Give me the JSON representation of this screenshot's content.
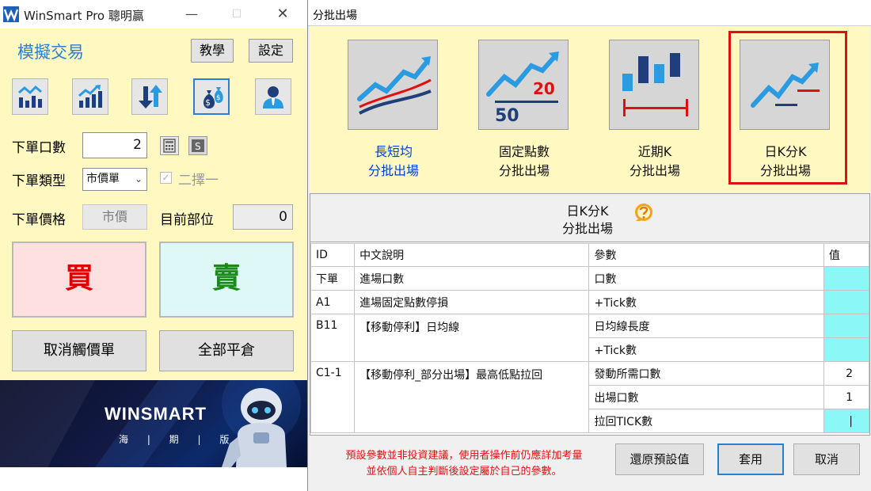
{
  "left_window": {
    "title": "WinSmart Pro 聰明贏",
    "controls": {
      "minimize": "—",
      "maximize": "☐",
      "close": "✕"
    },
    "simulated_trading_title": "模擬交易",
    "tutorial_label": "教學",
    "settings_label": "設定",
    "tool_icons": [
      "bar-chart-icon",
      "trend-chart-icon",
      "transfer-arrows-icon",
      "money-bag-icon",
      "user-icon"
    ],
    "qty_label": "下單口數",
    "qty_value": "2",
    "order_type_label": "下單類型",
    "order_type_value": "市價單",
    "either_label": "二擇一",
    "either_checked": true,
    "price_label": "下單價格",
    "price_value": "市價",
    "position_label": "目前部位",
    "position_value": "0",
    "buy_label": "買",
    "sell_label": "賣",
    "cancel_trigger_label": "取消觸價單",
    "close_all_label": "全部平倉",
    "banner": {
      "brand": "WINSMART",
      "subtitle": "海 | 期 | 版"
    }
  },
  "dialog": {
    "title": "分批出場",
    "modes": [
      {
        "line1": "長短均",
        "line2": "分批出場",
        "icon": "moving-average-icon"
      },
      {
        "line1": "固定點數",
        "line2": "分批出場",
        "icon": "fixed-points-icon",
        "numerator": "20",
        "denominator": "50"
      },
      {
        "line1": "近期K",
        "line2": "分批出場",
        "icon": "recent-k-icon"
      },
      {
        "line1": "日K分K",
        "line2": "分批出場",
        "icon": "daily-minute-k-icon",
        "selected": true
      }
    ],
    "detail_title_1": "日K分K",
    "detail_title_2": "分批出場",
    "table": {
      "headers": [
        "ID",
        "中文說明",
        "參數",
        "值"
      ],
      "rows": [
        {
          "id": "下單",
          "desc": "進場口數",
          "param": "口數",
          "value": ""
        },
        {
          "id": "A1",
          "desc": "進場固定點數停損",
          "param": "+Tick數",
          "value": ""
        },
        {
          "id": "B11",
          "desc": "【移動停利】日均線",
          "param": "日均線長度",
          "value": ""
        },
        {
          "id": "",
          "desc": "",
          "param": "+Tick數",
          "value": ""
        },
        {
          "id": "C1-1",
          "desc": "【移動停利_部分出場】最高低點拉回",
          "param": "發動所需口數",
          "value": "2"
        },
        {
          "id": "",
          "desc": "",
          "param": "出場口數",
          "value": "1"
        },
        {
          "id": "",
          "desc": "",
          "param": "拉回TICK數",
          "value": "|"
        }
      ]
    },
    "disclaimer_1": "預設參數並非投資建議，使用者操作前仍應詳加考量",
    "disclaimer_2": "並依個人自主判斷後設定屬於自己的參數。",
    "restore_label": "還原預設值",
    "apply_label": "套用",
    "cancel_label": "取消"
  },
  "colors": {
    "panel_yellow": "#fff8c0",
    "accent_blue": "#2a7fd0",
    "highlight_red": "#e01010",
    "value_cyan": "#8cf7f7",
    "buy_red": "#e00000",
    "sell_green": "#1a8a1a"
  }
}
